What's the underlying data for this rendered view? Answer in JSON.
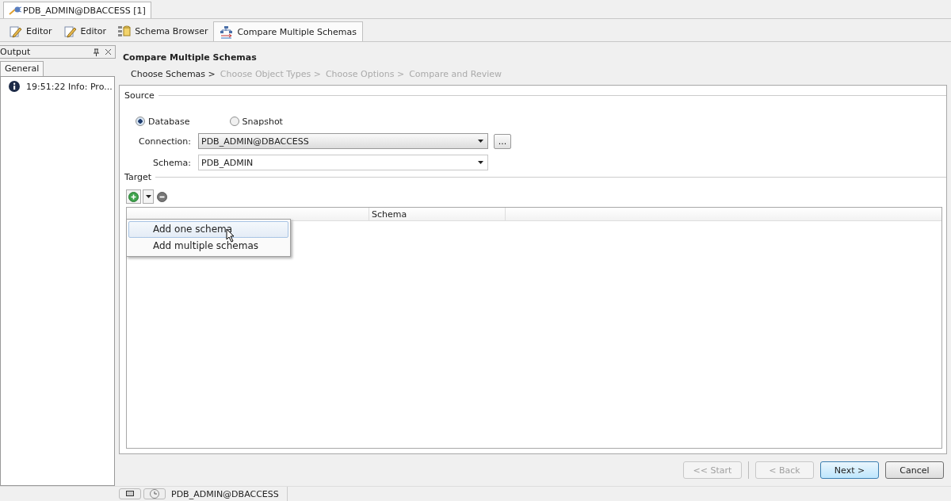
{
  "document_tab": {
    "title": "PDB_ADMIN@DBACCESS [1]"
  },
  "editor_tabs": [
    {
      "label": "Editor",
      "kind": "editor",
      "selected": false
    },
    {
      "label": "Editor",
      "kind": "editor",
      "selected": false
    },
    {
      "label": "Schema Browser",
      "kind": "browser",
      "selected": false
    },
    {
      "label": "Compare Multiple Schemas",
      "kind": "compare",
      "selected": true
    }
  ],
  "output_panel": {
    "title": "Output",
    "tabs": [
      {
        "label": "General",
        "selected": true
      }
    ],
    "messages": [
      "19:51:22 Info: Pro..."
    ]
  },
  "wizard": {
    "title": "Compare Multiple Schemas",
    "steps": [
      {
        "label": "Choose Schemas >",
        "selected": true
      },
      {
        "label": "Choose Object Types >",
        "selected": false
      },
      {
        "label": "Choose Options >",
        "selected": false
      },
      {
        "label": "Compare and Review",
        "selected": false
      }
    ],
    "source": {
      "legend": "Source",
      "options": [
        {
          "label": "Database",
          "selected": true
        },
        {
          "label": "Snapshot",
          "selected": false
        }
      ],
      "connection": {
        "label": "Connection:",
        "value": "PDB_ADMIN@DBACCESS",
        "browse": "..."
      },
      "schema": {
        "label": "Schema:",
        "value": "PDB_ADMIN"
      }
    },
    "target": {
      "legend": "Target",
      "columns": [
        "Schema"
      ],
      "menu": [
        {
          "label": "Add one schema",
          "selected": true
        },
        {
          "label": "Add multiple schemas",
          "selected": false
        }
      ]
    },
    "buttons": [
      {
        "label": "<< Start",
        "disabled": true
      },
      {
        "label": "< Back",
        "disabled": true
      },
      {
        "label": "Next >",
        "disabled": false,
        "default": true
      },
      {
        "label": "Cancel",
        "disabled": false,
        "default": false
      }
    ]
  },
  "status_bar": {
    "connection": "PDB_ADMIN@DBACCESS"
  }
}
